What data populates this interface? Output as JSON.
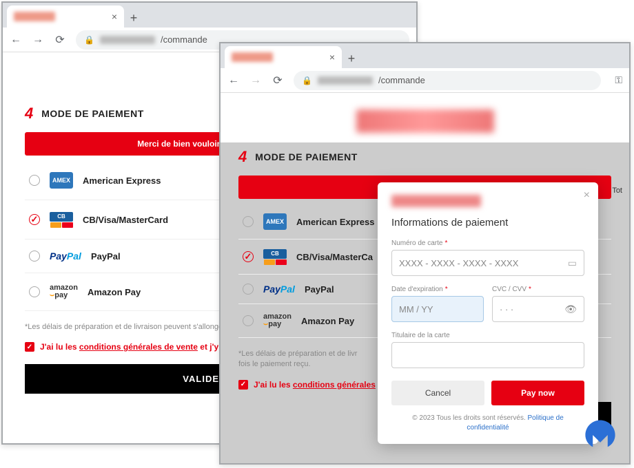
{
  "browser": {
    "url_path": "/commande",
    "new_tab": "+",
    "close_tab": "×"
  },
  "checkout": {
    "step_number": "4",
    "step_title": "MODE DE PAIEMENT",
    "alert_full": "Merci de bien vouloir accepter nos C",
    "alert_truncated": "Merci de bien vou",
    "options": [
      {
        "label": "American Express",
        "id": "amex"
      },
      {
        "label": "CB/Visa/MasterCard",
        "id": "cb"
      },
      {
        "label": "PayPal",
        "id": "paypal"
      },
      {
        "label": "Amazon Pay",
        "id": "amazon"
      }
    ],
    "cb_label_truncated": "CB/Visa/MasterCa",
    "fine_print_full": "*Les délais de préparation et de livraison peuvent s'allonger une fois le paiement reçu.",
    "fine_print_short_a": "*Les délais de préparation et de livr",
    "fine_print_short_b": "fois le paiement reçu.",
    "consent_prefix": "J'ai lu les ",
    "consent_link": "conditions générales de vente",
    "consent_suffix": " et j'y ad",
    "consent_link_short": "conditions générales",
    "validate_label": "VALIDER E",
    "side_total": "Tot"
  },
  "modal": {
    "title": "Informations de paiement",
    "card_number_label": "Numéro de carte",
    "card_number_placeholder": "XXXX - XXXX - XXXX - XXXX",
    "expiry_label": "Date d'expiration",
    "expiry_placeholder": "MM / YY",
    "cvc_label": "CVC / CVV",
    "cvc_placeholder": "· · ·",
    "holder_label": "Titulaire de la carte",
    "cancel_label": "Cancel",
    "pay_label": "Pay now",
    "footer_copyright": "© 2023 Tous les droits sont réservés. ",
    "footer_link": "Politique de confidentialité",
    "required_mark": "*"
  },
  "paypal": {
    "p1": "Pay",
    "p2": "Pal"
  },
  "amazon": {
    "line1": "amazon",
    "line2": "pay"
  }
}
